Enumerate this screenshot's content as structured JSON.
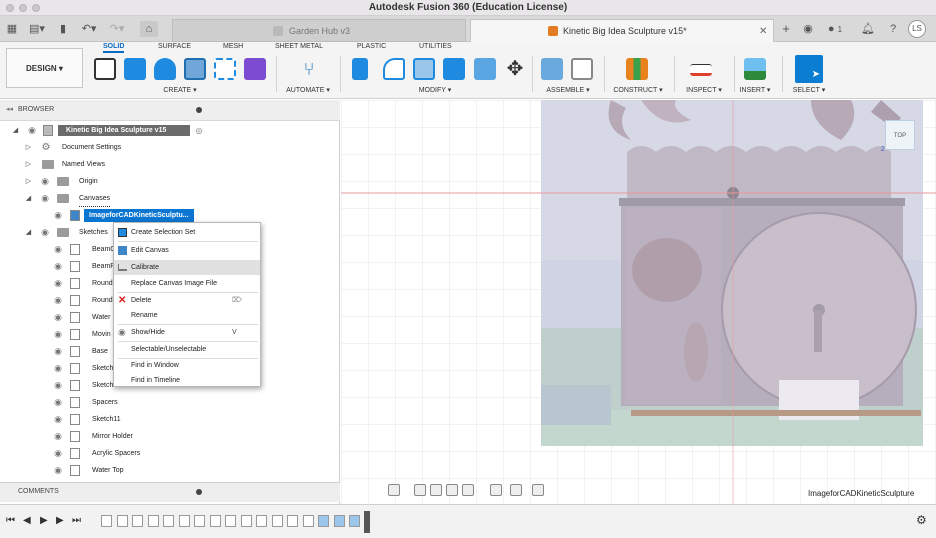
{
  "app": {
    "title": "Autodesk Fusion 360 (Education License)"
  },
  "tabs": [
    {
      "label": "Garden Hub v3"
    },
    {
      "label": "Kinetic Big Idea Sculpture v15*"
    }
  ],
  "tabbar": {
    "notif_count": "1",
    "user_initials": "LS"
  },
  "workspace": {
    "label": "DESIGN ▾"
  },
  "ribbon_tabs": [
    "SOLID",
    "SURFACE",
    "MESH",
    "SHEET METAL",
    "PLASTIC",
    "UTILITIES"
  ],
  "ribbon_groups": [
    "CREATE ▾",
    "AUTOMATE ▾",
    "MODIFY ▾",
    "ASSEMBLE ▾",
    "CONSTRUCT ▾",
    "INSPECT ▾",
    "INSERT ▾",
    "SELECT ▾"
  ],
  "browser": {
    "title": "BROWSER",
    "root": "Kinetic Big Idea Sculpture v15",
    "items": [
      "Document Settings",
      "Named Views",
      "Origin",
      "Canvases"
    ],
    "canvas_item": "ImageforCADKineticSculptu...",
    "sketches_label": "Sketches",
    "sketches": [
      "BeamC",
      "BeamP",
      "Round",
      "Round",
      "Water",
      "Movin",
      "Base",
      "Sketch",
      "Sketch",
      "Spacers",
      "Sketch11",
      "Mirror Holder",
      "Acrylic Spacers",
      "Water Top"
    ]
  },
  "comments": {
    "label": "COMMENTS"
  },
  "context_menu": {
    "items": [
      "Create Selection Set",
      "Edit Canvas",
      "Calibrate",
      "Replace Canvas Image File",
      "Delete",
      "Rename",
      "Show/Hide",
      "Selectable/Unselectable",
      "Find in Window",
      "Find in Timeline"
    ],
    "shortcut_show": "V",
    "highlighted": "Calibrate"
  },
  "viewport": {
    "canvas_label": "ImageforCADKineticSculpture",
    "viewcube_label": "TOP"
  },
  "colors": {
    "accent": "#0a6bc2",
    "selected": "#0b76d1",
    "delete": "#d92020",
    "menu_highlight": "#e1e1e1"
  },
  "timeline_marker_count": 17
}
